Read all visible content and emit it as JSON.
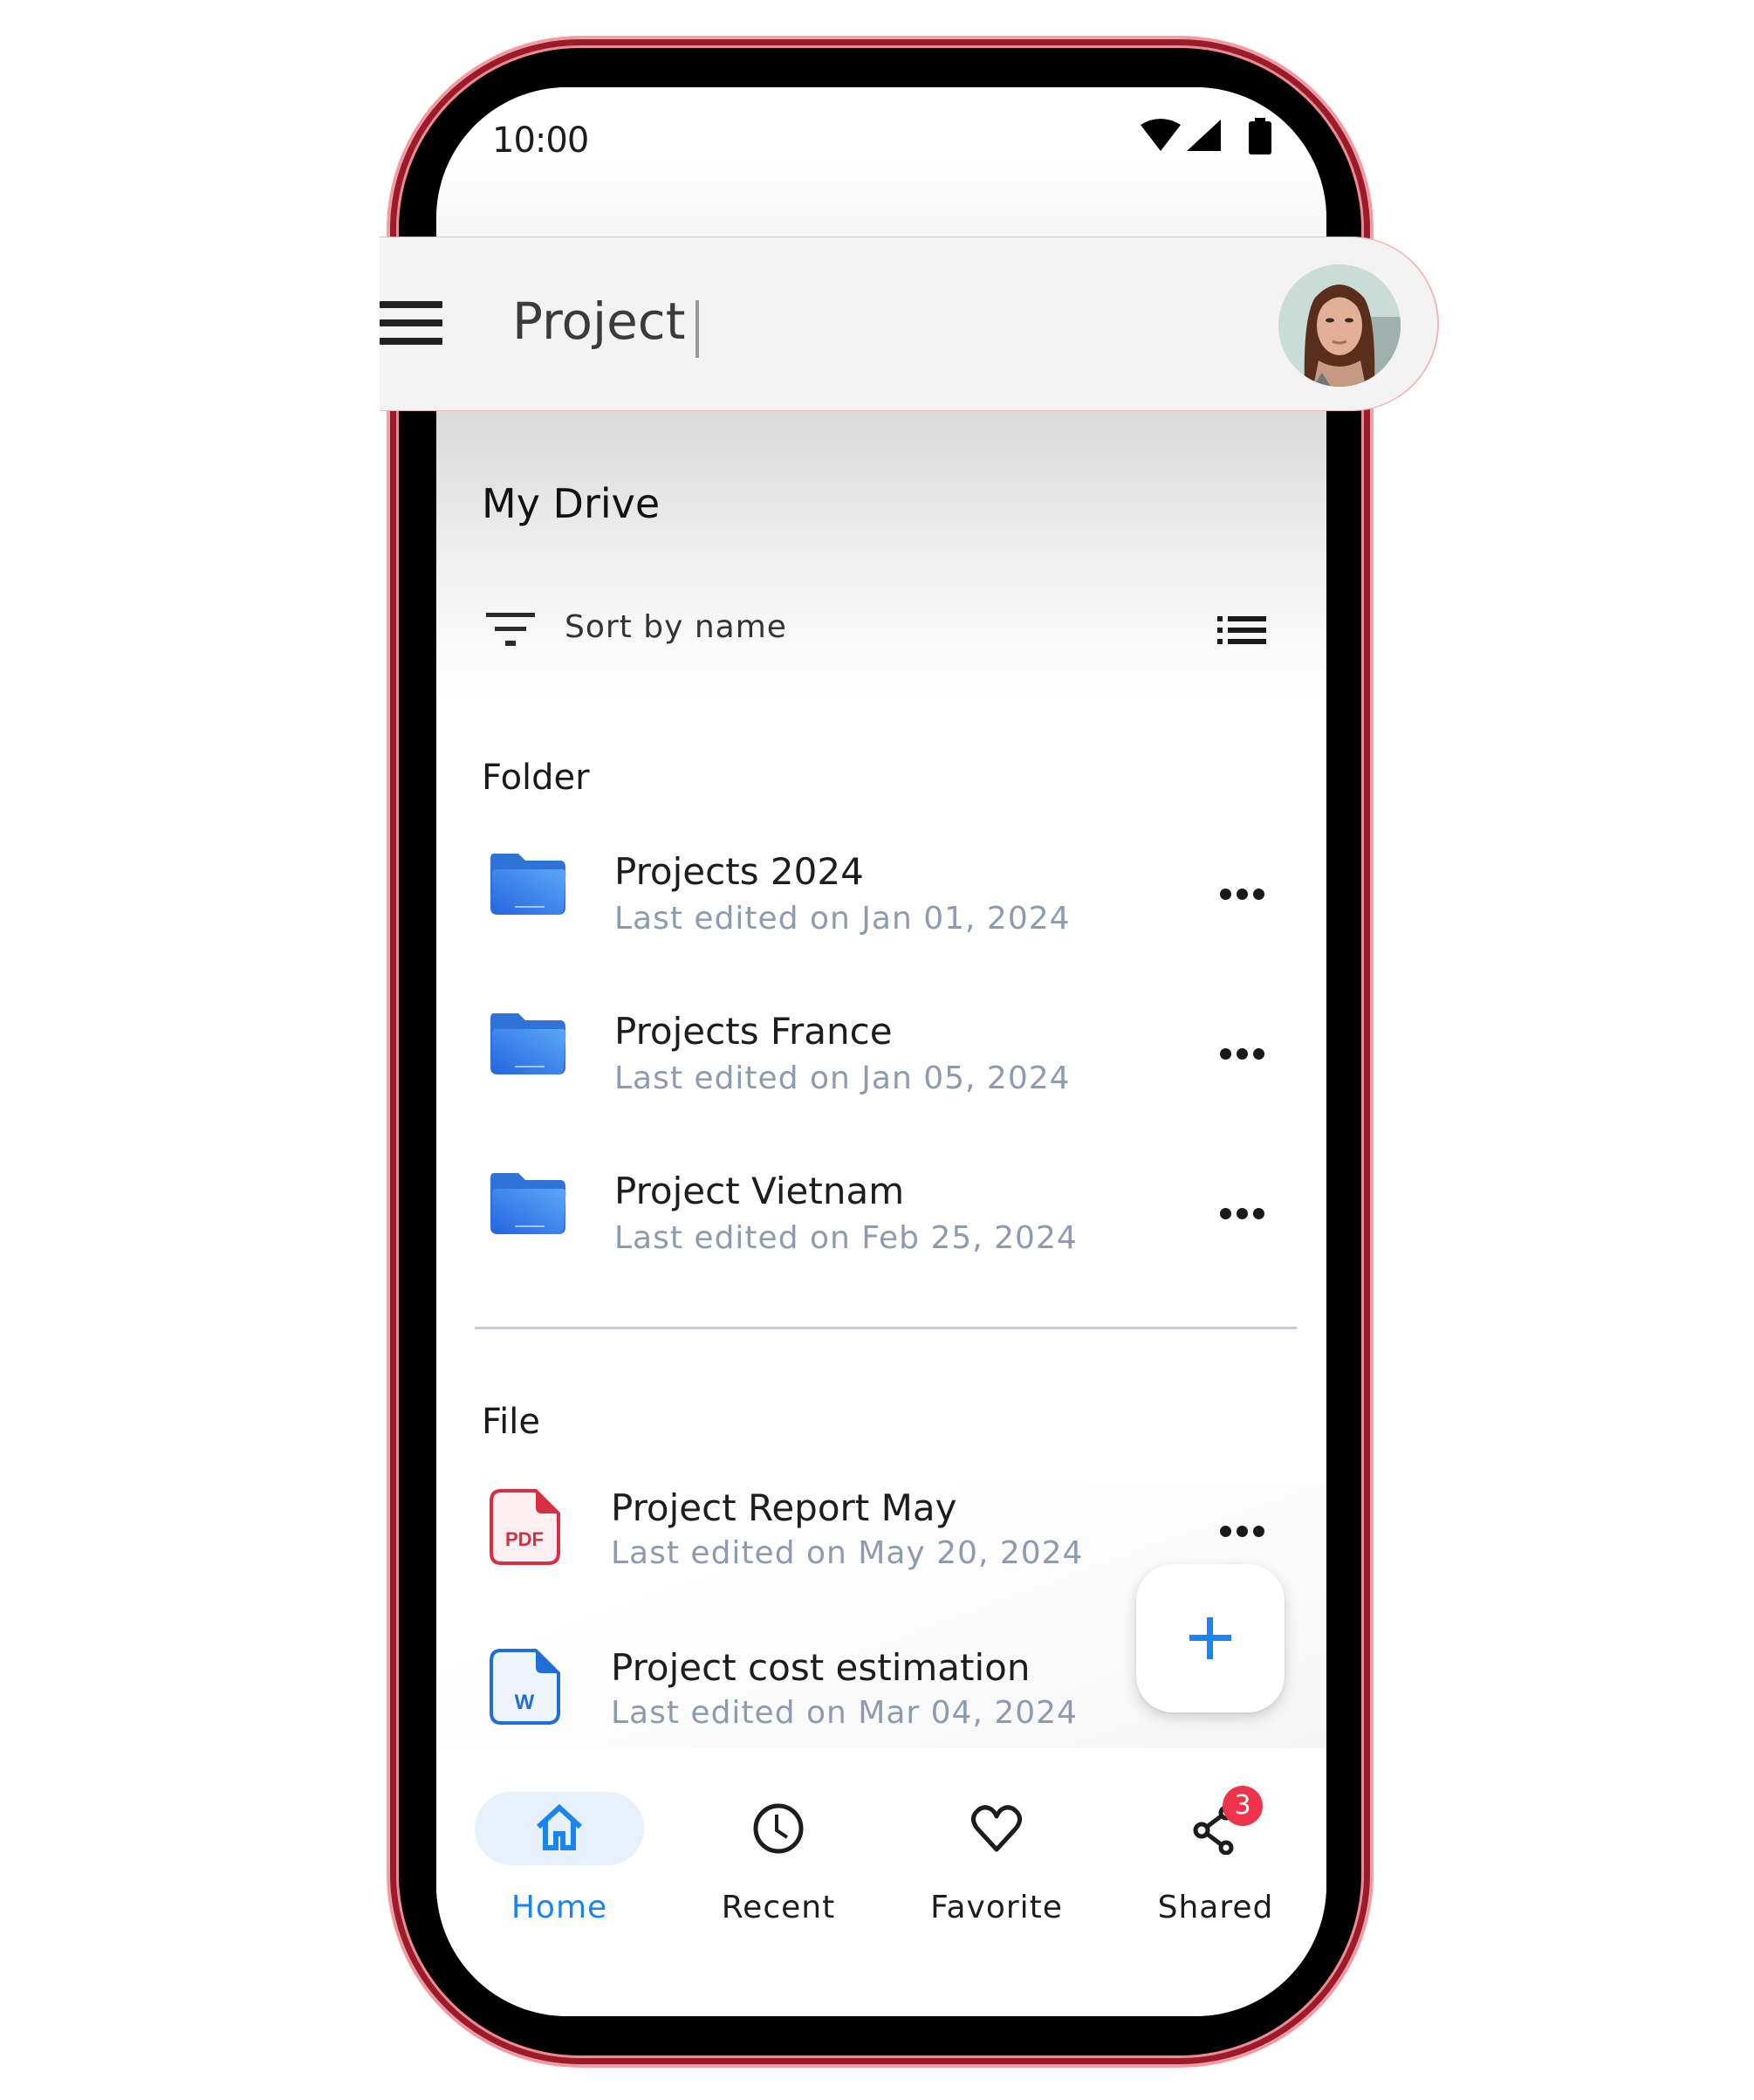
{
  "status_bar": {
    "time": "10:00",
    "icons": [
      "wifi-icon",
      "signal-icon",
      "battery-icon"
    ]
  },
  "search": {
    "value": "Project",
    "menu_icon": "hamburger-menu-icon",
    "avatar": "user-avatar"
  },
  "page": {
    "title": "My Drive",
    "sort_label": "Sort by name",
    "sort_icon": "filter-sort-icon",
    "view_icon": "list-view-icon"
  },
  "folders": {
    "heading": "Folder",
    "items": [
      {
        "name": "Projects 2024",
        "subtitle": "Last edited on Jan 01, 2024"
      },
      {
        "name": "Projects France",
        "subtitle": "Last edited on Jan 05, 2024"
      },
      {
        "name": "Project Vietnam",
        "subtitle": "Last edited on Feb 25, 2024"
      }
    ]
  },
  "files": {
    "heading": "File",
    "items": [
      {
        "name": "Project Report May",
        "subtitle": "Last edited on May 20, 2024",
        "type": "PDF"
      },
      {
        "name": "Project cost estimation",
        "subtitle": "Last edited on Mar 04, 2024",
        "type": "W"
      }
    ]
  },
  "fab": {
    "icon": "plus-icon"
  },
  "bottom_nav": {
    "items": [
      {
        "label": "Home",
        "icon": "home-icon",
        "active": true
      },
      {
        "label": "Recent",
        "icon": "clock-icon",
        "active": false
      },
      {
        "label": "Favorite",
        "icon": "heart-icon",
        "active": false
      },
      {
        "label": "Shared",
        "icon": "share-icon",
        "active": false,
        "badge": "3"
      }
    ]
  },
  "colors": {
    "accent": "#1a85f0",
    "frame": "#9b1b2a",
    "badge": "#f0334a",
    "pdf": "#d42f43",
    "word": "#1f6fd6",
    "folder": "#2f7be3",
    "subtitle": "#8d9bb0"
  }
}
